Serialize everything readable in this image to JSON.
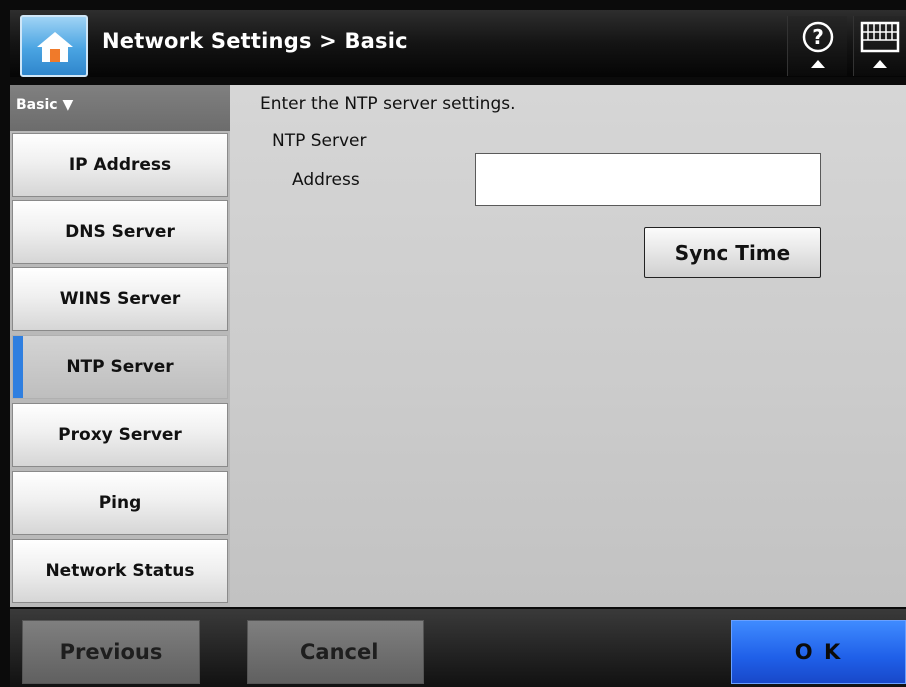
{
  "header": {
    "title": "Network Settings > Basic",
    "home_icon": "home-icon",
    "help_icon": "question-icon",
    "keyboard_icon": "keyboard-icon"
  },
  "sidebar": {
    "section_label": "Basic",
    "section_arrow": "▼",
    "items": [
      {
        "label": "IP Address",
        "active": false
      },
      {
        "label": "DNS Server",
        "active": false
      },
      {
        "label": "WINS Server",
        "active": false
      },
      {
        "label": "NTP Server",
        "active": true
      },
      {
        "label": "Proxy Server",
        "active": false
      },
      {
        "label": "Ping",
        "active": false
      },
      {
        "label": "Network Status",
        "active": false
      }
    ]
  },
  "main": {
    "instruction": "Enter the NTP server settings.",
    "section_label": "NTP Server",
    "address_label": "Address",
    "address_value": "",
    "sync_button": "Sync Time"
  },
  "footer": {
    "previous": "Previous",
    "cancel": "Cancel",
    "ok": "O K"
  },
  "colors": {
    "accent_blue": "#2f7fe0",
    "ok_blue": "#1f5fe8",
    "home_blue": "#4aa4e2"
  }
}
